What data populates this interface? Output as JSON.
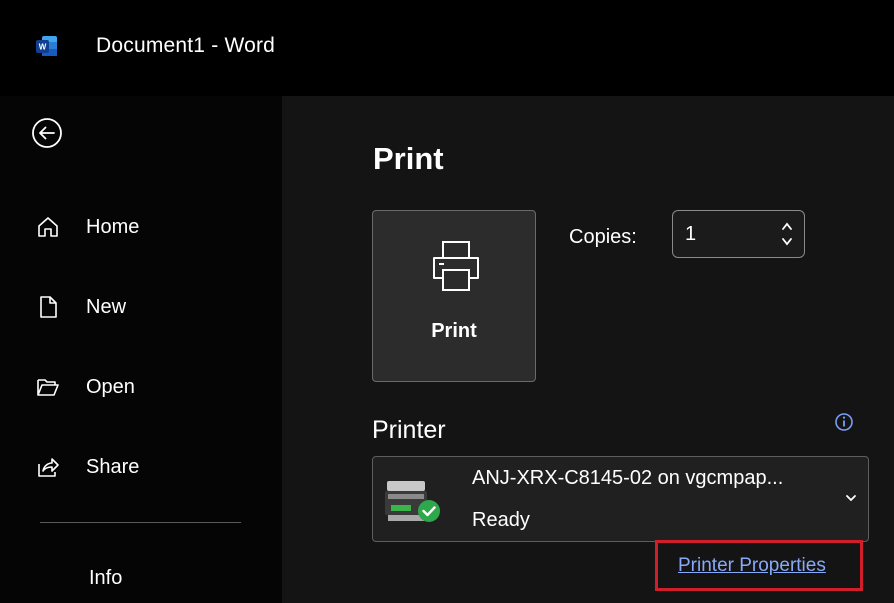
{
  "window": {
    "title": "Document1  -  Word",
    "app_icon": "word-app-icon",
    "accent_color": "#185abd"
  },
  "sidebar": {
    "back_icon": "back-arrow-icon",
    "items": [
      {
        "label": "Home",
        "icon": "home-icon"
      },
      {
        "label": "New",
        "icon": "new-document-icon"
      },
      {
        "label": "Open",
        "icon": "folder-open-icon"
      },
      {
        "label": "Share",
        "icon": "share-icon"
      }
    ],
    "info_label": "Info"
  },
  "print": {
    "heading": "Print",
    "button_label": "Print",
    "copies_label": "Copies:",
    "copies_value": "1"
  },
  "printer": {
    "heading": "Printer",
    "name": "ANJ-XRX-C8145-02 on vgcmpap...",
    "status": "Ready",
    "properties_link": "Printer Properties",
    "ready_color": "#2ea84a",
    "highlight_color": "#d01f2a",
    "link_color": "#87a9f8"
  }
}
